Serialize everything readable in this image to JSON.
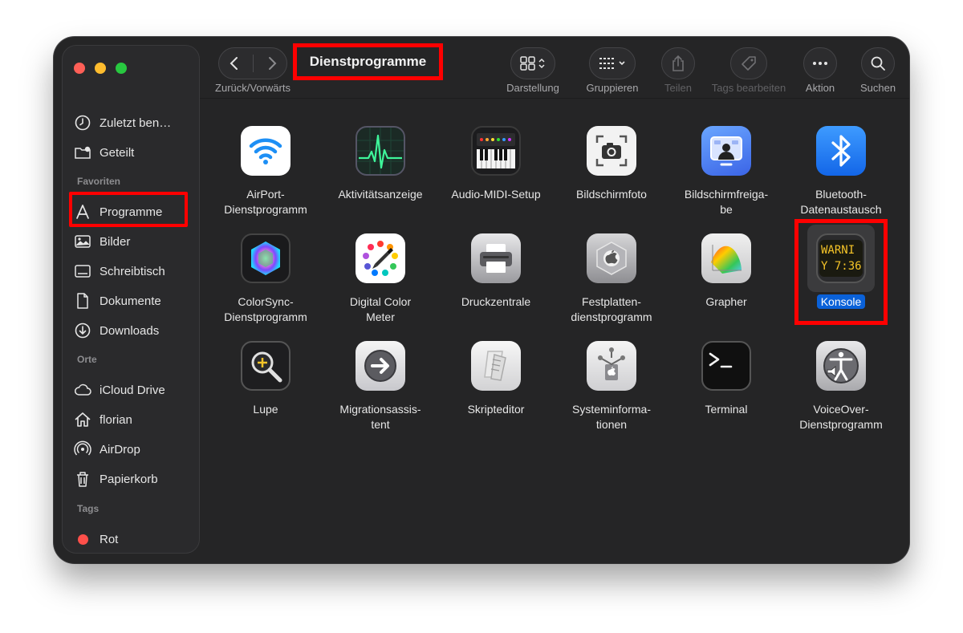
{
  "window": {
    "title": "Dienstprogramme"
  },
  "toolbar": {
    "nav_label": "Zurück/Vorwärts",
    "view_label": "Darstellung",
    "group_label": "Gruppieren",
    "share_label": "Teilen",
    "tags_label": "Tags bearbeiten",
    "action_label": "Aktion",
    "search_label": "Suchen"
  },
  "sidebar": {
    "top_items": [
      {
        "label": "Zuletzt ben…",
        "icon": "clock-icon"
      },
      {
        "label": "Geteilt",
        "icon": "shared-folder-icon"
      }
    ],
    "favorites_title": "Favoriten",
    "favorites": [
      {
        "label": "Programme",
        "icon": "applications-icon"
      },
      {
        "label": "Bilder",
        "icon": "photo-icon"
      },
      {
        "label": "Schreibtisch",
        "icon": "desktop-icon"
      },
      {
        "label": "Dokumente",
        "icon": "document-icon"
      },
      {
        "label": "Downloads",
        "icon": "download-icon"
      }
    ],
    "locations_title": "Orte",
    "locations": [
      {
        "label": "iCloud Drive",
        "icon": "cloud-icon"
      },
      {
        "label": "florian",
        "icon": "home-icon"
      },
      {
        "label": "AirDrop",
        "icon": "airdrop-icon"
      },
      {
        "label": "Papierkorb",
        "icon": "trash-icon"
      }
    ],
    "tags_title": "Tags",
    "tags": [
      {
        "label": "Rot",
        "color": "#fe4f4a"
      }
    ]
  },
  "apps": [
    {
      "line1": "AirPort-",
      "line2": "Dienstprogramm",
      "icon": "wifi-icon"
    },
    {
      "line1": "Aktivitätsanzeige",
      "line2": "",
      "icon": "activity-monitor-icon"
    },
    {
      "line1": "Audio-MIDI-Setup",
      "line2": "",
      "icon": "midi-keyboard-icon"
    },
    {
      "line1": "Bildschirmfoto",
      "line2": "",
      "icon": "screenshot-camera-icon"
    },
    {
      "line1": "Bildschirmfreiga-",
      "line2": "be",
      "icon": "screen-sharing-icon"
    },
    {
      "line1": "Bluetooth-",
      "line2": "Datenaustausch",
      "icon": "bluetooth-icon"
    },
    {
      "line1": "ColorSync-",
      "line2": "Dienstprogramm",
      "icon": "colorsync-icon"
    },
    {
      "line1": "Digital Color",
      "line2": "Meter",
      "icon": "color-meter-icon"
    },
    {
      "line1": "Druckzentrale",
      "line2": "",
      "icon": "printer-icon"
    },
    {
      "line1": "Festplatten-",
      "line2": "dienstprogramm",
      "icon": "disk-utility-icon"
    },
    {
      "line1": "Grapher",
      "line2": "",
      "icon": "grapher-icon"
    },
    {
      "line1": "Konsole",
      "line2": "",
      "icon": "console-icon",
      "selected": true,
      "screen_line1": "WARNI",
      "screen_line2": "Y 7:36"
    },
    {
      "line1": "Lupe",
      "line2": "",
      "icon": "magnifier-icon"
    },
    {
      "line1": "Migrationsassis-",
      "line2": "tent",
      "icon": "migration-arrow-icon"
    },
    {
      "line1": "Skripteditor",
      "line2": "",
      "icon": "script-editor-icon"
    },
    {
      "line1": "Systeminforma-",
      "line2": "tionen",
      "icon": "system-info-icon"
    },
    {
      "line1": "Terminal",
      "line2": "",
      "icon": "terminal-icon"
    },
    {
      "line1": "VoiceOver-",
      "line2": "Dienstprogramm",
      "icon": "voiceover-icon"
    }
  ]
}
